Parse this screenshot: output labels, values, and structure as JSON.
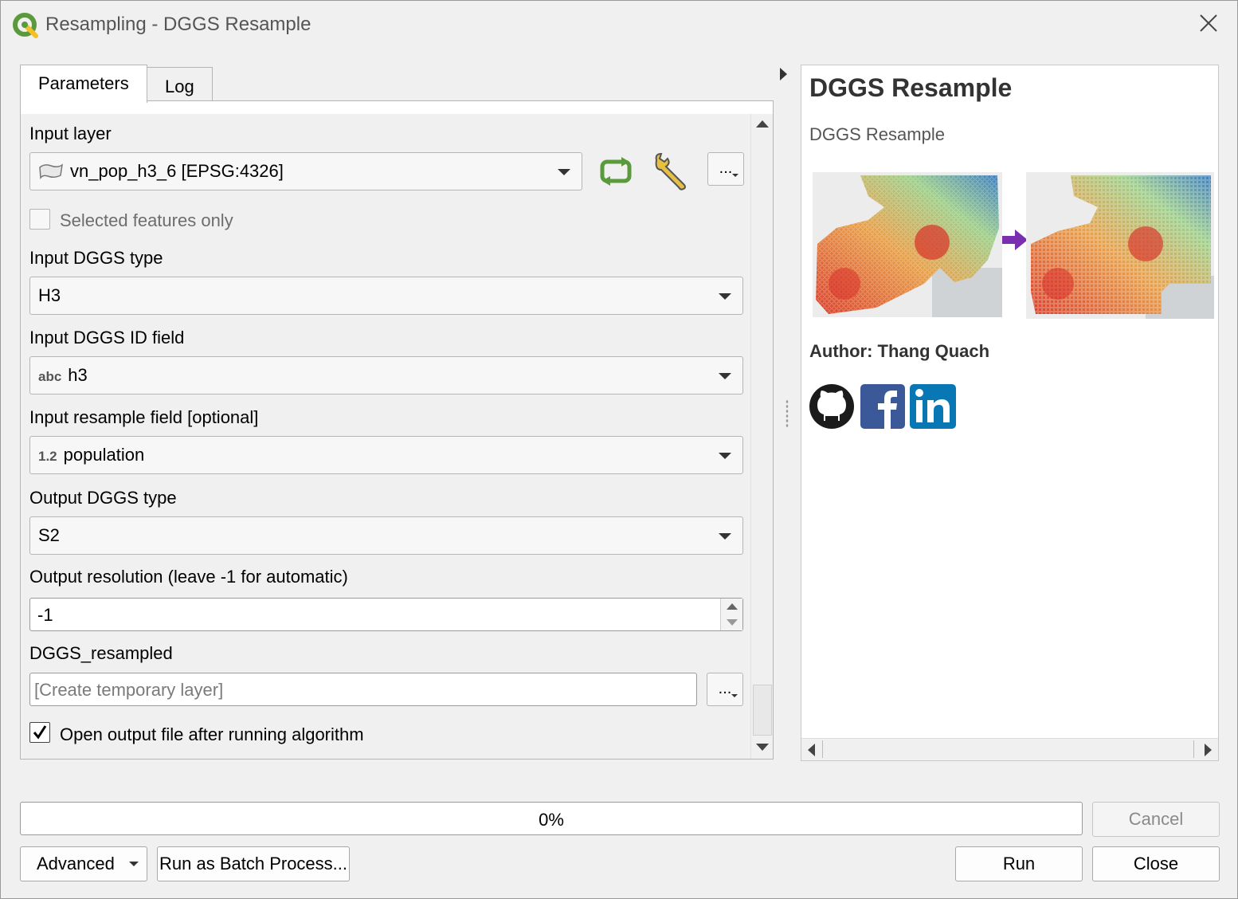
{
  "window": {
    "title": "Resampling - DGGS Resample",
    "title_icon": "qgis-logo-icon",
    "close_icon": "close-icon"
  },
  "tabs": [
    {
      "label": "Parameters",
      "active": true
    },
    {
      "label": "Log",
      "active": false
    }
  ],
  "params": {
    "input_layer": {
      "label": "Input layer",
      "value": "vn_pop_h3_6 [EPSG:4326]",
      "layer_icon": "polygon-layer-icon",
      "iterate_icon": "iterate-features-icon",
      "settings_icon": "wrench-icon",
      "browse_label": "..."
    },
    "selected_only": {
      "label": "Selected features only",
      "checked": false
    },
    "input_dggs_type": {
      "label": "Input DGGS type",
      "value": "H3"
    },
    "input_dggs_id_field": {
      "label": "Input DGGS ID field",
      "type_tag": "abc",
      "value": "h3"
    },
    "input_resample_field": {
      "label": "Input resample field [optional]",
      "type_tag": "1.2",
      "value": "population"
    },
    "output_dggs_type": {
      "label": "Output DGGS type",
      "value": "S2"
    },
    "output_resolution": {
      "label": "Output resolution (leave -1 for automatic)",
      "value": "-1"
    },
    "output": {
      "label": "DGGS_resampled",
      "placeholder": "[Create temporary layer]",
      "browse_label": "..."
    },
    "open_output": {
      "label": "Open output file after running algorithm",
      "checked": true
    }
  },
  "help": {
    "title": "DGGS Resample",
    "subtitle": "DGGS Resample",
    "author": "Author: Thang Quach",
    "image_icons": [
      "hex-map-before-image",
      "arrow-right-icon",
      "hex-map-after-image"
    ],
    "social_icons": [
      "github-icon",
      "facebook-icon",
      "linkedin-icon"
    ]
  },
  "progress": {
    "text": "0%",
    "value": 0
  },
  "buttons": {
    "cancel": "Cancel",
    "advanced": "Advanced",
    "batch": "Run as Batch Process...",
    "run": "Run",
    "close": "Close"
  },
  "colors": {
    "accent_green": "#5a9a3c",
    "arrow_purple": "#7a2fb0",
    "facebook_blue": "#3b5998",
    "linkedin_blue": "#0a77b5"
  }
}
